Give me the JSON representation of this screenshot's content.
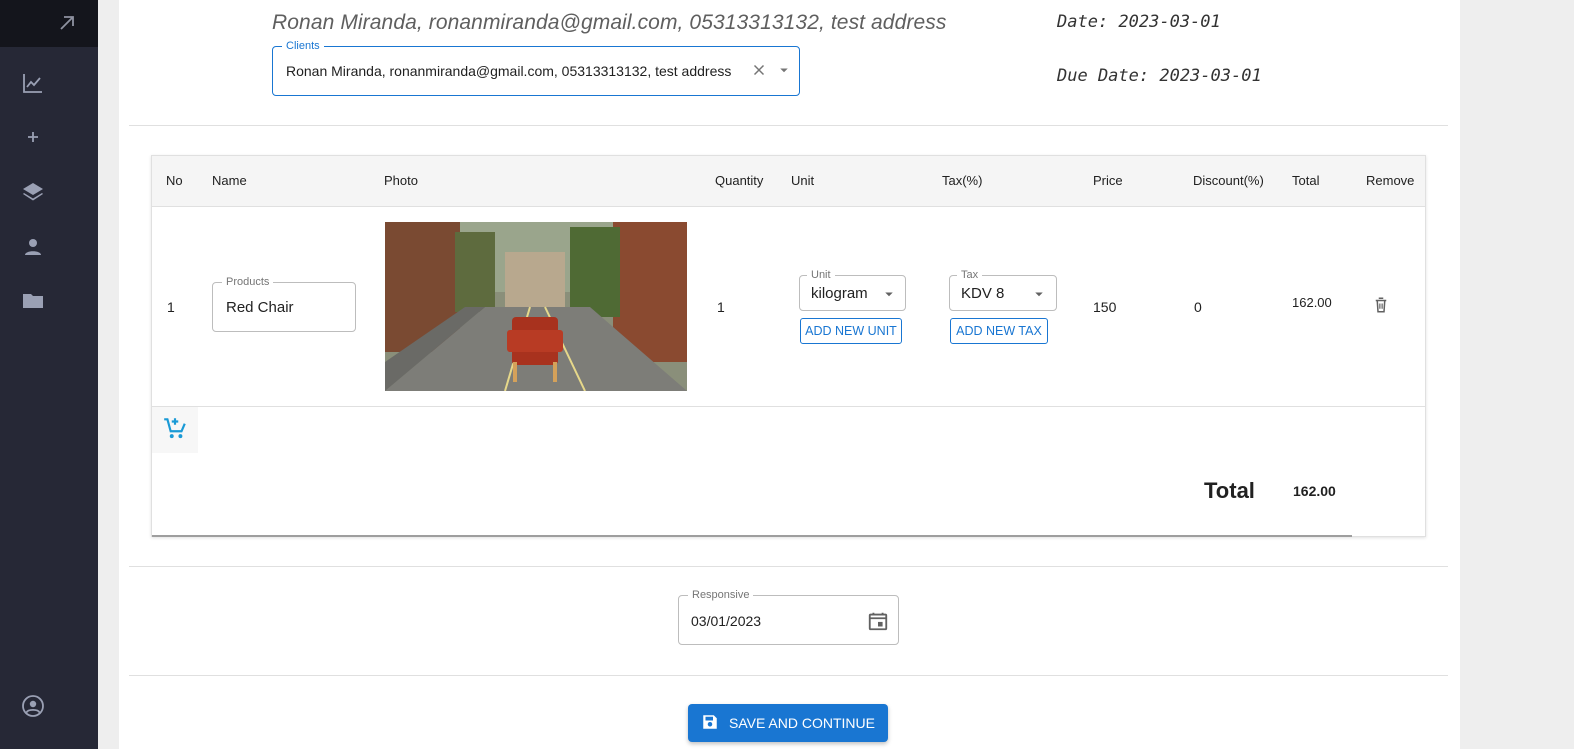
{
  "sidebar": {
    "icons": [
      "arrow-up-right-icon",
      "chart-line-icon",
      "plus-icon",
      "layers-icon",
      "person-icon",
      "folder-icon",
      "account-circle-icon"
    ]
  },
  "invoice": {
    "client_line": "Ronan Miranda, ronanmiranda@gmail.com, 05313313132, test address",
    "date": "Date: 2023-03-01",
    "due_date": "Due Date: 2023-03-01",
    "clients_label": "Clients",
    "clients_value": "Ronan Miranda, ronanmiranda@gmail.com, 05313313132, test address"
  },
  "table": {
    "headers": [
      "No",
      "Name",
      "Photo",
      "Quantity",
      "Unit",
      "Tax(%)",
      "Price",
      "Discount(%)",
      "Total",
      "Remove"
    ],
    "rows": [
      {
        "no": "1",
        "product_label": "Products",
        "product_value": "Red Chair",
        "quantity": "1",
        "unit_label": "Unit",
        "unit_value": "kilogram",
        "add_unit": "ADD NEW UNIT",
        "tax_label": "Tax",
        "tax_value": "KDV 8",
        "add_tax": "ADD NEW TAX",
        "price": "150",
        "discount": "0",
        "total": "162.00"
      }
    ],
    "grand_total_label": "Total",
    "grand_total_value": "162.00"
  },
  "date_picker": {
    "label": "Responsive",
    "value": "03/01/2023"
  },
  "actions": {
    "save_label": "SAVE AND CONTINUE"
  },
  "colors": {
    "sidebar": "#262836",
    "primary": "#1976d2"
  }
}
